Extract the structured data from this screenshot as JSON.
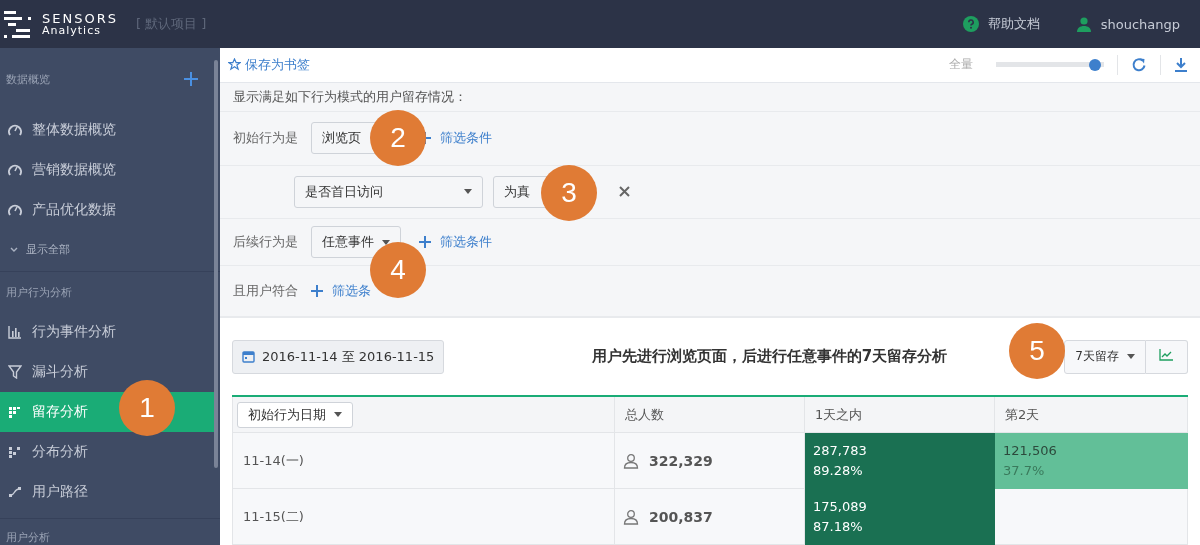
{
  "header": {
    "brand_top": "SENSORS",
    "brand_bottom": "Analytics",
    "project": "[ 默认项目 ]",
    "help": "帮助文档",
    "user": "shouchangp"
  },
  "sidebar": {
    "sections": [
      {
        "title": "数据概览",
        "add": true,
        "items": [
          {
            "label": "整体数据概览",
            "kind": "gauge",
            "selected": false
          },
          {
            "label": "营销数据概览",
            "kind": "gauge",
            "selected": false
          },
          {
            "label": "产品优化数据",
            "kind": "gauge",
            "selected": false
          }
        ],
        "more": "显示全部"
      },
      {
        "title": "用户行为分析",
        "items": [
          {
            "label": "行为事件分析",
            "kind": "bars",
            "selected": false
          },
          {
            "label": "漏斗分析",
            "kind": "funnel",
            "selected": false
          },
          {
            "label": "留存分析",
            "kind": "grid",
            "selected": true
          },
          {
            "label": "分布分析",
            "kind": "dots",
            "selected": false
          },
          {
            "label": "用户路径",
            "kind": "path",
            "selected": false
          }
        ]
      },
      {
        "title": "用户分析"
      }
    ]
  },
  "toolbar": {
    "bookmark": "保存为书签",
    "sample_label": "全量",
    "sample": {
      "level": 0.97
    }
  },
  "query": {
    "description": "显示满足如下行为模式的用户留存情况：",
    "rows": [
      {
        "kind": "event",
        "label": "初始行为是",
        "select": "浏览页",
        "filter": "筛选条件"
      },
      {
        "kind": "condition",
        "property": "是否首日访问",
        "operator": "为真"
      },
      {
        "kind": "event",
        "label": "后续行为是",
        "select": "任意事件",
        "filter": "筛选条件"
      },
      {
        "kind": "user",
        "label": "且用户符合",
        "filter": "筛选条"
      }
    ]
  },
  "report": {
    "date_range": "2016-11-14 至 2016-11-15",
    "title": "用户先进行浏览页面，后进行任意事件的7天留存分析",
    "period": "7天留存",
    "columns": [
      "初始行为日期",
      "总人数",
      "1天之内",
      "第2天"
    ],
    "rows": [
      {
        "date": "11-14(一)",
        "total": "322,329",
        "within_1_day": {
          "kind": "high",
          "count": "287,783",
          "rate": "89.28%"
        },
        "day_2": {
          "kind": "low",
          "count": "121,506",
          "rate": "37.7%"
        }
      },
      {
        "date": "11-15(二)",
        "total": "200,837",
        "within_1_day": {
          "kind": "high",
          "count": "175,089",
          "rate": "87.18%"
        }
      }
    ]
  },
  "callouts": [
    "1",
    "2",
    "3",
    "4",
    "5"
  ]
}
